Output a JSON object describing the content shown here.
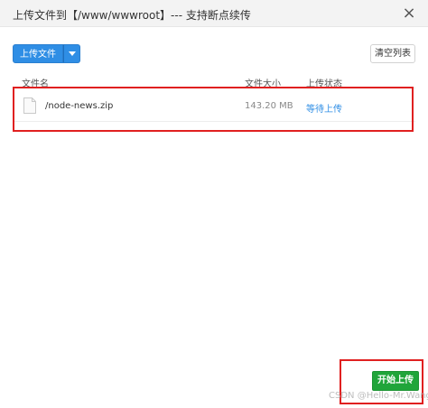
{
  "dialog": {
    "title": "上传文件到【/www/wwwroot】--- 支持断点续传",
    "close_icon": "close-icon"
  },
  "toolbar": {
    "upload_label": "上传文件",
    "clear_label": "清空列表"
  },
  "table": {
    "columns": [
      "文件名",
      "文件大小",
      "上传状态"
    ],
    "rows": [
      {
        "name": "/node-news.zip",
        "size": "143.20 MB",
        "status": "等待上传"
      }
    ]
  },
  "footer": {
    "start_label": "开始上传",
    "watermark": "CSDN @Hello-Mr.Wang"
  },
  "colors": {
    "primary": "#2f8ee5",
    "success": "#20a53a",
    "highlight": "#e02020"
  }
}
